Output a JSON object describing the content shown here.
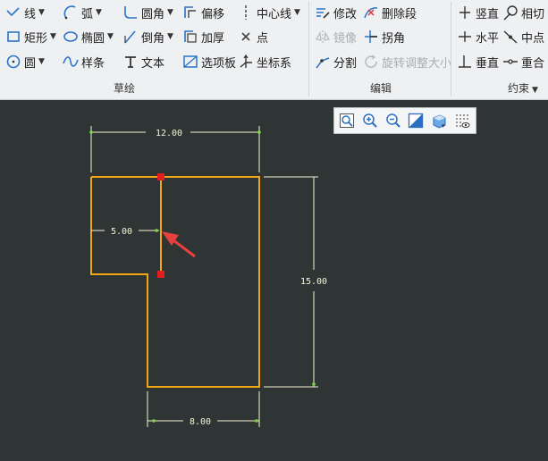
{
  "ribbon": {
    "sketch_group": {
      "label": "草绘",
      "line": "线",
      "arc": "弧",
      "fillet": "圆角",
      "offset": "偏移",
      "centerline": "中心线",
      "rectangle": "矩形",
      "ellipse": "椭圆",
      "chamfer": "倒角",
      "thicken": "加厚",
      "point": "点",
      "circle": "圆",
      "spline": "样条",
      "text": "文本",
      "palette": "选项板",
      "coord_system": "坐标系"
    },
    "edit_group": {
      "label": "编辑",
      "modify": "修改",
      "delete_segment": "删除段",
      "mirror": "镜像",
      "corner": "拐角",
      "divide": "分割",
      "rotate_resize": "旋转调整大小"
    },
    "constraint_group": {
      "label": "约束",
      "vertical": "竖直",
      "tangent": "相切",
      "horizontal": "水平",
      "midpoint": "中点",
      "perpendicular": "垂直",
      "coincident": "重合"
    }
  },
  "sketch": {
    "dim_top": "12.00",
    "dim_left": "5.00",
    "dim_right": "15.00",
    "dim_bottom": "8.00",
    "colors": {
      "profile": "#f2a516",
      "dimension": "#f4f4d6",
      "endpoint": "#e31e1e",
      "arrow": "#e8403f",
      "background": "#2f3535"
    }
  },
  "view_toolbar": {
    "icons": [
      "refit-icon",
      "zoom-in-icon",
      "zoom-out-icon",
      "repaint-icon",
      "display-style-icon",
      "sketch-display-icon"
    ]
  }
}
